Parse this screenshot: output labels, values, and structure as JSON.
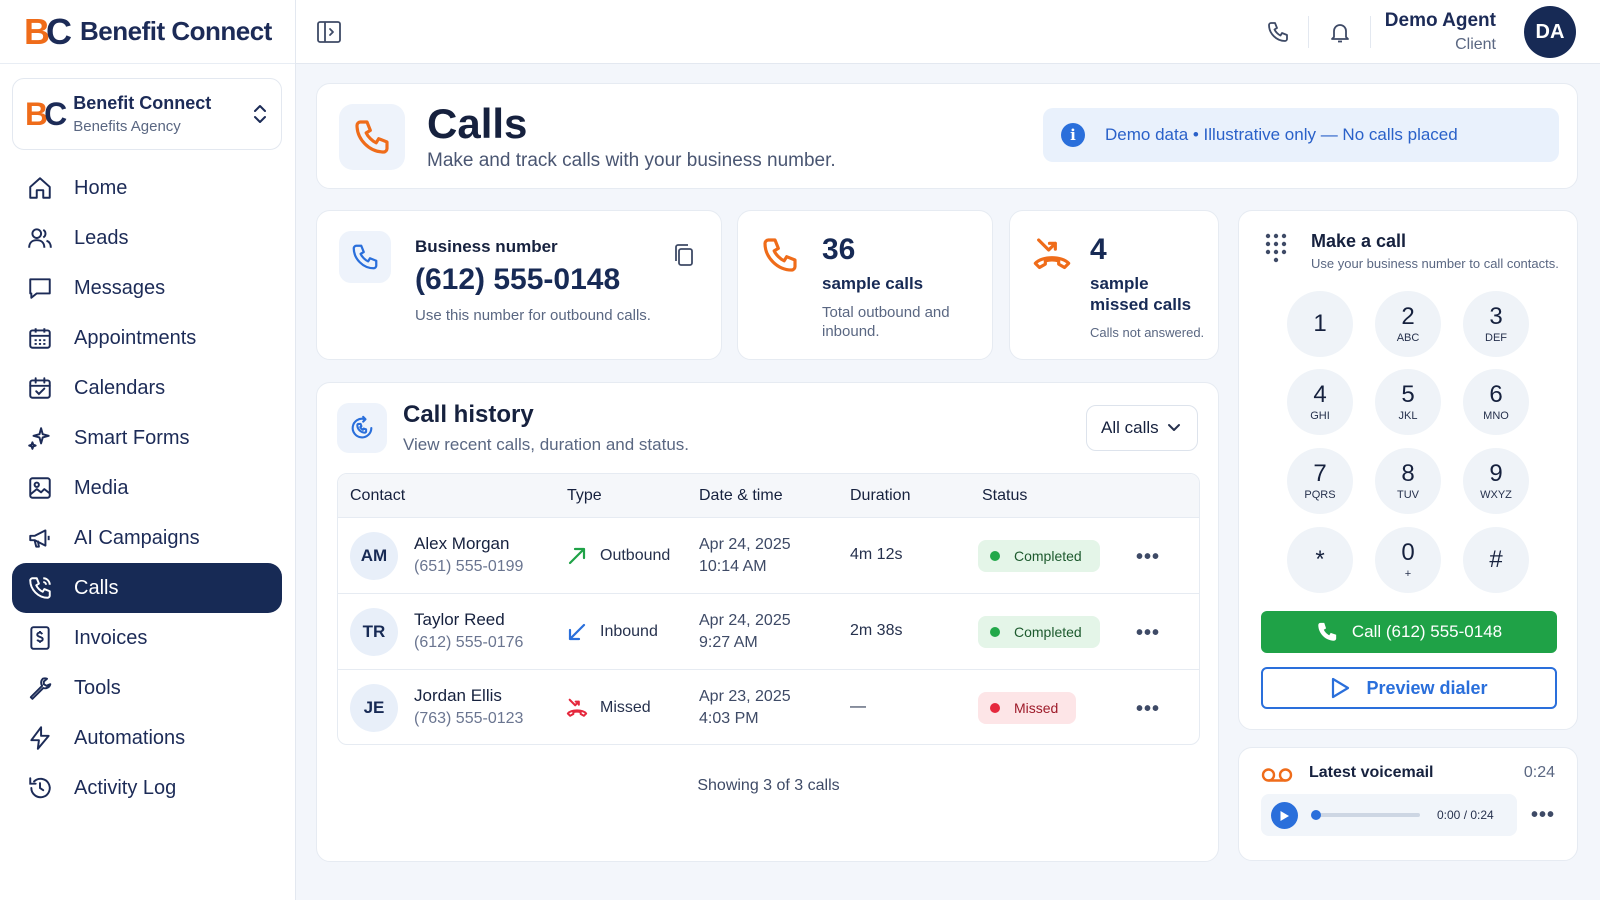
{
  "app": {
    "name": "Benefit Connect",
    "logo_b": "B",
    "logo_c": "C"
  },
  "org": {
    "name": "Benefit Connect",
    "type": "Benefits Agency"
  },
  "sidebar": {
    "items": [
      {
        "label": "Home",
        "icon": "home-icon"
      },
      {
        "label": "Leads",
        "icon": "users-icon"
      },
      {
        "label": "Messages",
        "icon": "message-icon"
      },
      {
        "label": "Appointments",
        "icon": "calendar-grid-icon"
      },
      {
        "label": "Calendars",
        "icon": "calendar-check-icon"
      },
      {
        "label": "Smart Forms",
        "icon": "sparkle-icon"
      },
      {
        "label": "Media",
        "icon": "image-icon"
      },
      {
        "label": "AI Campaigns",
        "icon": "megaphone-icon"
      },
      {
        "label": "Calls",
        "icon": "phone-icon",
        "active": true
      },
      {
        "label": "Invoices",
        "icon": "invoice-icon"
      },
      {
        "label": "Tools",
        "icon": "wrench-icon"
      },
      {
        "label": "Automations",
        "icon": "bolt-icon"
      },
      {
        "label": "Activity Log",
        "icon": "history-icon"
      }
    ]
  },
  "user": {
    "name": "Demo Agent",
    "role": "Client",
    "initials": "DA"
  },
  "page": {
    "title": "Calls",
    "subtitle": "Make and track calls with your business number.",
    "banner": "Demo data • Illustrative only — No calls placed",
    "banner_icon": "i"
  },
  "business": {
    "label": "Business number",
    "number": "(612) 555-0148",
    "note": "Use this number for outbound calls."
  },
  "stats": [
    {
      "value": "36",
      "label": "sample calls",
      "desc": "Total outbound and inbound."
    },
    {
      "value": "4",
      "label": "sample missed calls",
      "desc": "Calls not answered."
    }
  ],
  "history": {
    "title": "Call history",
    "subtitle": "View recent calls, duration and status.",
    "filter": "All calls",
    "columns": [
      "Contact",
      "Type",
      "Date & time",
      "Duration",
      "Status"
    ],
    "rows": [
      {
        "initials": "AM",
        "name": "Alex Morgan",
        "phone": "(651) 555-0199",
        "type": "Outbound",
        "date": "Apr 24, 2025",
        "time": "10:14 AM",
        "duration": "4m 12s",
        "status": "Completed"
      },
      {
        "initials": "TR",
        "name": "Taylor Reed",
        "phone": "(612) 555-0176",
        "type": "Inbound",
        "date": "Apr 24, 2025",
        "time": "9:27 AM",
        "duration": "2m 38s",
        "status": "Completed"
      },
      {
        "initials": "JE",
        "name": "Jordan Ellis",
        "phone": "(763) 555-0123",
        "type": "Missed",
        "date": "Apr 23, 2025",
        "time": "4:03 PM",
        "duration": "—",
        "status": "Missed"
      }
    ],
    "more": "•••",
    "footer": "Showing 3 of 3 calls"
  },
  "dialer": {
    "title": "Make a call",
    "subtitle": "Use your business number to call contacts.",
    "keys": [
      {
        "d": "1",
        "l": ""
      },
      {
        "d": "2",
        "l": "ABC"
      },
      {
        "d": "3",
        "l": "DEF"
      },
      {
        "d": "4",
        "l": "GHI"
      },
      {
        "d": "5",
        "l": "JKL"
      },
      {
        "d": "6",
        "l": "MNO"
      },
      {
        "d": "7",
        "l": "PQRS"
      },
      {
        "d": "8",
        "l": "TUV"
      },
      {
        "d": "9",
        "l": "WXYZ"
      },
      {
        "d": "*",
        "l": ""
      },
      {
        "d": "0",
        "l": "+"
      },
      {
        "d": "#",
        "l": ""
      }
    ],
    "call_label": "Call (612) 555-0148",
    "preview_label": "Preview dialer"
  },
  "voicemail": {
    "title": "Latest voicemail",
    "duration": "0:24",
    "progress": "0:00 / 0:24",
    "more": "•••"
  },
  "colors": {
    "brand_navy": "#172a55",
    "brand_orange": "#ef6c1a",
    "accent_blue": "#2a6fdb",
    "success": "#1fa247",
    "danger": "#e5283d"
  }
}
